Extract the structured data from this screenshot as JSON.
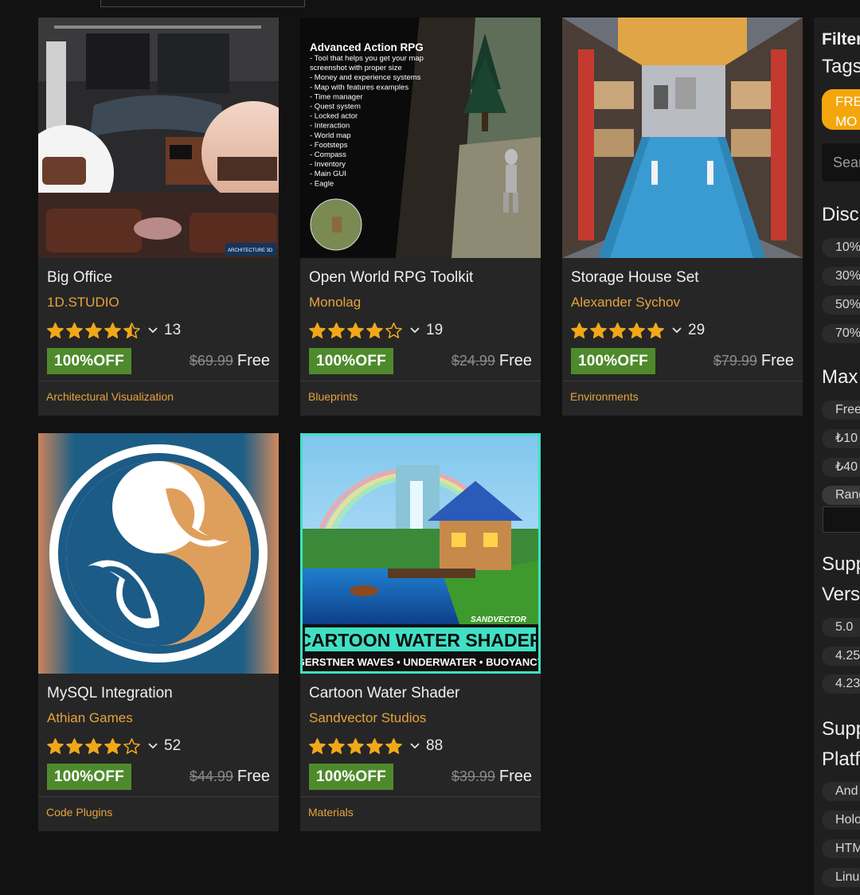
{
  "header": {
    "search_value": ""
  },
  "products": [
    {
      "title": "Big Office",
      "seller": "1D.STUDIO",
      "rating": 4.5,
      "rating_count": "13",
      "discount_label": "100%OFF",
      "original_price": "$69.99",
      "price": "Free",
      "category": "Architectural Visualization",
      "thumb_text": "ARCHITECTURE 3D"
    },
    {
      "title": "Open World RPG Toolkit",
      "seller": "Monolag",
      "rating": 4,
      "rating_count": "19",
      "discount_label": "100%OFF",
      "original_price": "$24.99",
      "price": "Free",
      "category": "Blueprints",
      "thumb_heading": "Advanced Action RPG",
      "thumb_lines": [
        "- Tool that helps you get your map",
        "screenshot with proper size",
        "- Money and experience systems",
        "- Map with features examples",
        "- Time manager",
        "- Quest system",
        "- Locked actor",
        "- Interaction",
        "- World map",
        "- Footsteps",
        "- Compass",
        "- Inventory",
        "- Main GUI",
        "- Eagle"
      ]
    },
    {
      "title": "Storage House Set",
      "seller": "Alexander Sychov",
      "rating": 5,
      "rating_count": "29",
      "discount_label": "100%OFF",
      "original_price": "$79.99",
      "price": "Free",
      "category": "Environments"
    },
    {
      "title": "MySQL Integration",
      "seller": "Athian Games",
      "rating": 4,
      "rating_count": "52",
      "discount_label": "100%OFF",
      "original_price": "$44.99",
      "price": "Free",
      "category": "Code Plugins"
    },
    {
      "title": "Cartoon Water Shader",
      "seller": "Sandvector Studios",
      "rating": 5,
      "rating_count": "88",
      "discount_label": "100%OFF",
      "original_price": "$39.99",
      "price": "Free",
      "category": "Materials",
      "thumb_brand": "SANDVECTOR",
      "thumb_title": "CARTOON WATER SHADER",
      "thumb_subtitle": "GERSTNER WAVES • UNDERWATER • BUOYANCY"
    }
  ],
  "sidebar": {
    "filter_heading": "Filter",
    "tags_heading": "Tags",
    "tag_line1": "FRE",
    "tag_line2": "MO",
    "search_placeholder": "Sear",
    "discount_heading": "Disc",
    "discount_options": [
      "10%",
      "30%",
      "50%",
      "70%"
    ],
    "max_price_heading": "Max",
    "max_price_options": [
      "Free",
      "₺10",
      "₺40",
      "Rang"
    ],
    "engine_heading_1": "Supp",
    "engine_heading_2": "Vers",
    "engine_versions": [
      "5.0",
      "4.25",
      "4.23"
    ],
    "platform_heading_1": "Supp",
    "platform_heading_2": "Platf",
    "platforms": [
      "And",
      "Holo",
      "HTM",
      "Linu"
    ]
  },
  "colors": {
    "accent": "#e8a33c",
    "badge_green": "#4e8a2c",
    "tag_orange": "#f3a70c",
    "star": "#f0a81a",
    "card_bg": "#262626",
    "highlight_border": "#3fe0c5"
  }
}
